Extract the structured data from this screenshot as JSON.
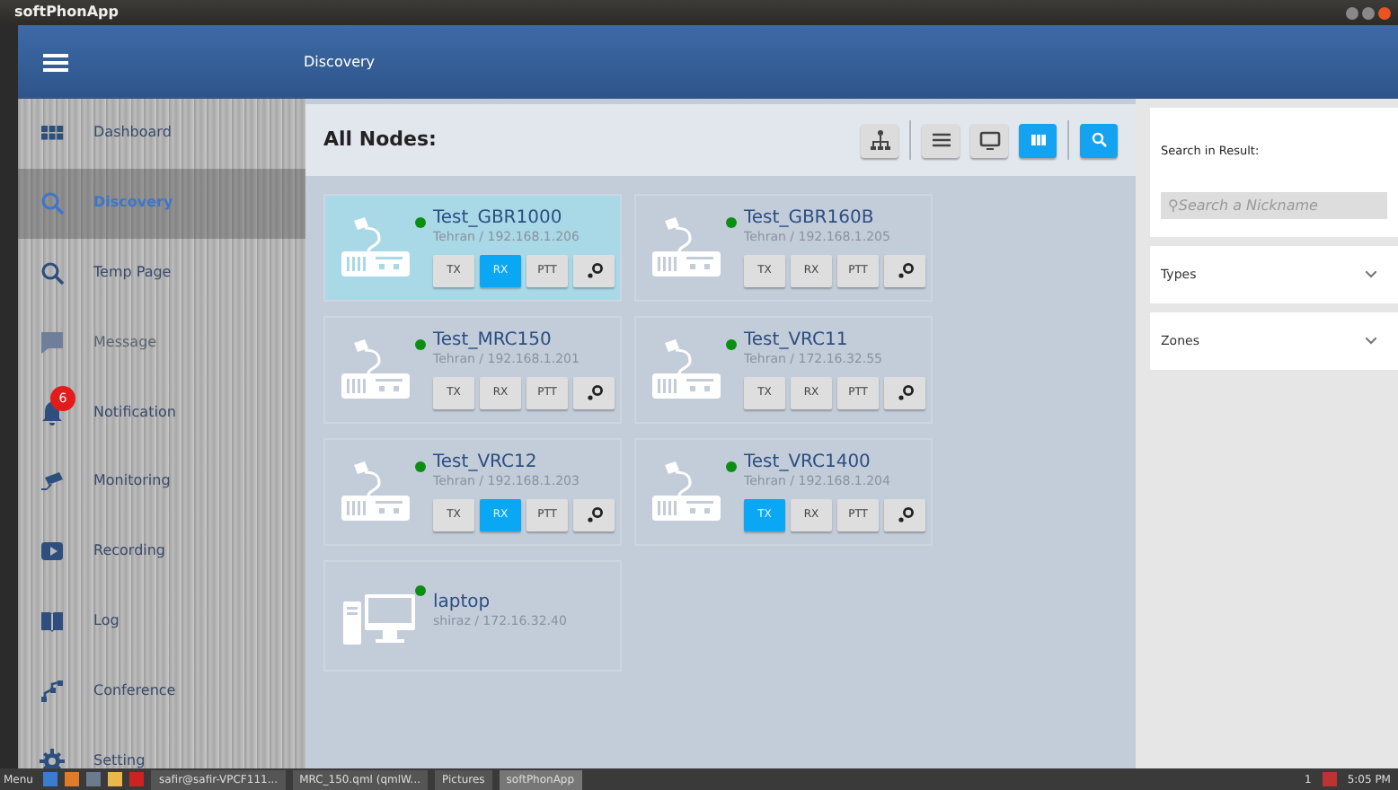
{
  "window": {
    "title": "softPhonApp"
  },
  "header": {
    "title": "Discovery"
  },
  "sidebar": {
    "items": [
      {
        "label": "Dashboard",
        "kind": "grid",
        "selected": false,
        "disabled": false
      },
      {
        "label": "Discovery",
        "kind": "search",
        "selected": true,
        "disabled": false
      },
      {
        "label": "Temp Page",
        "kind": "search",
        "selected": false,
        "disabled": false
      },
      {
        "label": "Message",
        "kind": "message",
        "selected": false,
        "disabled": true
      },
      {
        "label": "Notification",
        "kind": "bell",
        "selected": false,
        "disabled": false,
        "badge": "6"
      },
      {
        "label": "Monitoring",
        "kind": "camera",
        "selected": false,
        "disabled": false
      },
      {
        "label": "Recording",
        "kind": "play",
        "selected": false,
        "disabled": false
      },
      {
        "label": "Log",
        "kind": "book",
        "selected": false,
        "disabled": false
      },
      {
        "label": "Conference",
        "kind": "conference",
        "selected": false,
        "disabled": false
      },
      {
        "label": "Setting",
        "kind": "gear",
        "selected": false,
        "disabled": false
      }
    ]
  },
  "nodes_panel": {
    "title": "All Nodes:",
    "toolbar": [
      {
        "kind": "network",
        "selected": false
      },
      {
        "kind": "list",
        "selected": false
      },
      {
        "kind": "monitor",
        "selected": false
      },
      {
        "kind": "grid",
        "selected": true
      },
      {
        "kind": "search",
        "selected": true
      }
    ],
    "nodes": [
      {
        "kind": "radio",
        "name": "Test_GBR1000",
        "location": "Tehran / 192.168.1.206",
        "selected": true,
        "online": true,
        "buttons": [
          {
            "label": "TX",
            "on": false
          },
          {
            "label": "RX",
            "on": true
          },
          {
            "label": "PTT",
            "on": false
          }
        ]
      },
      {
        "kind": "radio",
        "name": "Test_GBR160B",
        "location": "Tehran / 192.168.1.205",
        "selected": false,
        "online": true,
        "buttons": [
          {
            "label": "TX",
            "on": false
          },
          {
            "label": "RX",
            "on": false
          },
          {
            "label": "PTT",
            "on": false
          }
        ]
      },
      {
        "kind": "radio",
        "name": "Test_MRC150",
        "location": "Tehran / 192.168.1.201",
        "selected": false,
        "online": true,
        "buttons": [
          {
            "label": "TX",
            "on": false
          },
          {
            "label": "RX",
            "on": false
          },
          {
            "label": "PTT",
            "on": false
          }
        ]
      },
      {
        "kind": "radio",
        "name": "Test_VRC11",
        "location": "Tehran / 172.16.32.55",
        "selected": false,
        "online": true,
        "buttons": [
          {
            "label": "TX",
            "on": false
          },
          {
            "label": "RX",
            "on": false
          },
          {
            "label": "PTT",
            "on": false
          }
        ]
      },
      {
        "kind": "radio",
        "name": "Test_VRC12",
        "location": "Tehran / 192.168.1.203",
        "selected": false,
        "online": true,
        "buttons": [
          {
            "label": "TX",
            "on": false
          },
          {
            "label": "RX",
            "on": true
          },
          {
            "label": "PTT",
            "on": false
          }
        ]
      },
      {
        "kind": "radio",
        "name": "Test_VRC1400",
        "location": "Tehran / 192.168.1.204",
        "selected": false,
        "online": true,
        "buttons": [
          {
            "label": "TX",
            "on": true
          },
          {
            "label": "RX",
            "on": false
          },
          {
            "label": "PTT",
            "on": false
          }
        ]
      },
      {
        "kind": "computer",
        "name": "laptop",
        "location": "shiraz / 172.16.32.40",
        "selected": false,
        "online": true
      }
    ]
  },
  "filter_panel": {
    "search_label": "Search in Result:",
    "search": {
      "placeholder": "⚲Search a Nickname"
    },
    "sections": [
      {
        "label": "Types",
        "expanded": false
      },
      {
        "label": "Zones",
        "expanded": false
      }
    ]
  },
  "taskbar": {
    "menu": "Menu",
    "tasks": [
      {
        "label": "safir@safir-VPCF111...",
        "selected": false
      },
      {
        "label": "MRC_150.qml (qmlW...",
        "selected": false
      },
      {
        "label": "Pictures",
        "selected": false
      },
      {
        "label": "softPhonApp",
        "selected": true
      }
    ],
    "tray_count": "1",
    "clock": "5:05 PM"
  }
}
